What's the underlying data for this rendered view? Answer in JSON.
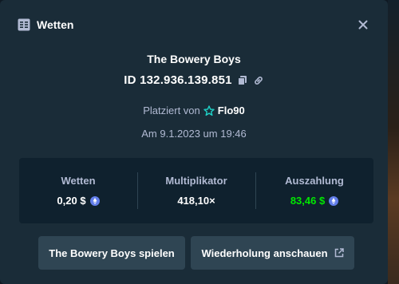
{
  "header": {
    "title": "Wetten",
    "icon": "bet-slip-icon",
    "close_icon": "close-icon"
  },
  "bet": {
    "game_name": "The Bowery Boys",
    "id_text": "ID 132.936.139.851",
    "placed_by_label": "Platziert von",
    "username": "Flo90",
    "date_text": "Am 9.1.2023 um 19:46"
  },
  "stats": {
    "wager_label": "Wetten",
    "wager_value": "0,20 $",
    "multiplier_label": "Multiplikator",
    "multiplier_value": "418,10×",
    "payout_label": "Auszahlung",
    "payout_value": "83,46 $"
  },
  "actions": {
    "play_label": "The Bowery Boys spielen",
    "replay_label": "Wiederholung anschauen"
  },
  "colors": {
    "modal_bg": "#1a2c38",
    "panel_bg": "#0f212e",
    "button_bg": "#2f4553",
    "muted_text": "#b1bad3",
    "payout_green": "#00e701",
    "coin_blue": "#627eea",
    "star_teal": "#1fd1c7"
  }
}
